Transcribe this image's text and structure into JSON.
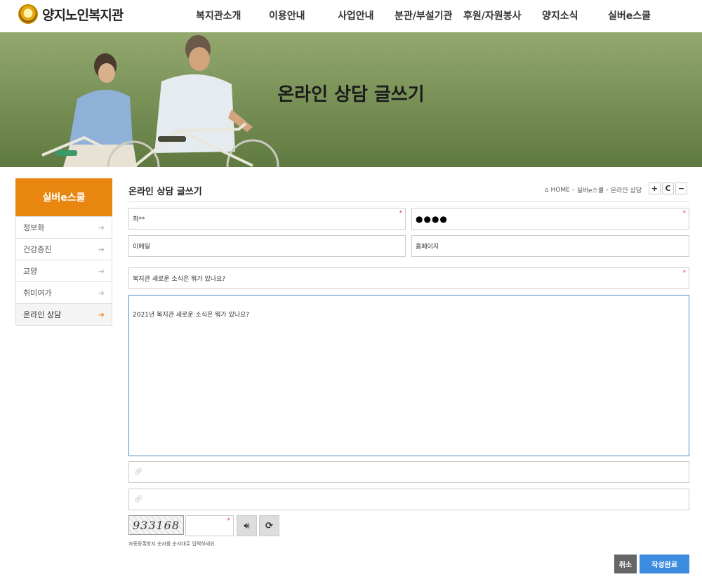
{
  "logo": {
    "text": "양지노인복지관"
  },
  "nav": {
    "items": [
      {
        "label": "복지관소개"
      },
      {
        "label": "이용안내"
      },
      {
        "label": "사업안내"
      },
      {
        "label": "분관/부설기관"
      },
      {
        "label": "후원/자원봉사"
      },
      {
        "label": "양지소식"
      },
      {
        "label": "실버e스쿨"
      }
    ]
  },
  "hero": {
    "title": "온라인 상담 글쓰기"
  },
  "sidebar": {
    "heading": "실버e스쿨",
    "items": [
      {
        "label": "정보화"
      },
      {
        "label": "건강증진"
      },
      {
        "label": "교양"
      },
      {
        "label": "취미여가"
      },
      {
        "label": "온라인 상담",
        "active": true
      }
    ]
  },
  "content": {
    "title": "온라인 상담 글쓰기"
  },
  "breadcrumb": {
    "home": "HOME",
    "level1": "실버e스쿨",
    "level2": "온라인 상담"
  },
  "tools": {
    "plus": "+",
    "reset": "C",
    "minus": "−"
  },
  "form": {
    "name_value": "최**",
    "password_mask": "●●●●",
    "email_placeholder": "이메일",
    "homepage_placeholder": "홈페이지",
    "subject_value": "복지관 새로운 소식은 뭐가 있나요?",
    "content_value": "2021년 복지관 새로운 소식은 뭐가 있나요?",
    "link1_value": "",
    "link2_value": "",
    "required_mark": "*"
  },
  "captcha": {
    "image_text": "933168",
    "input_value": "",
    "help": "자동등록방지 숫자를 순서대로 입력하세요."
  },
  "buttons": {
    "cancel": "취소",
    "submit": "작성완료"
  },
  "colors": {
    "accent": "#e8860f",
    "primary": "#3c8de0",
    "required": "#e53935"
  }
}
